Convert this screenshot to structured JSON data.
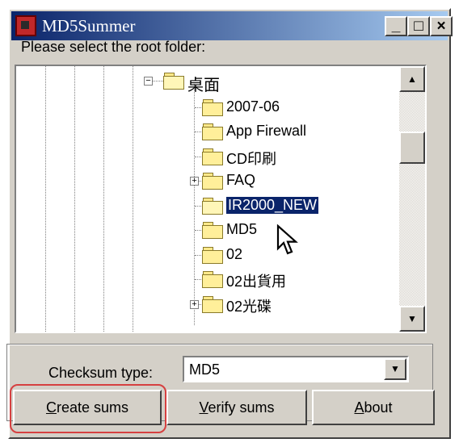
{
  "window": {
    "title": "MD5Summer",
    "minimize_glyph": "_",
    "maximize_glyph": "□",
    "close_glyph": "×"
  },
  "prompt": "Please select the root folder:",
  "tree": {
    "items": [
      {
        "label": "桌面",
        "open": true,
        "expander": "−",
        "selected": false
      },
      {
        "label": "2007-06",
        "open": false,
        "expander": "",
        "selected": false
      },
      {
        "label": "App Firewall",
        "open": false,
        "expander": "",
        "selected": false
      },
      {
        "label": "CD印刷",
        "open": false,
        "expander": "",
        "selected": false
      },
      {
        "label": "FAQ",
        "open": false,
        "expander": "+",
        "selected": false
      },
      {
        "label": "IR2000_NEW",
        "open": true,
        "expander": "",
        "selected": true
      },
      {
        "label": "MD5",
        "open": false,
        "expander": "",
        "selected": false
      },
      {
        "label": "02",
        "open": false,
        "expander": "",
        "selected": false
      },
      {
        "label": "02出貨用",
        "open": false,
        "expander": "",
        "selected": false
      },
      {
        "label": "02光碟",
        "open": false,
        "expander": "+",
        "selected": false
      }
    ],
    "scroll_up": "▲",
    "scroll_down": "▼"
  },
  "checksum": {
    "label": "Checksum type:",
    "value": "MD5",
    "arrow": "▼"
  },
  "buttons": {
    "create_label": "Create sums",
    "verify_label": "Verify sums",
    "about_label": "About"
  },
  "colors": {
    "highlight": "#d64040",
    "selection": "#0a246a",
    "title_bar": "#0a246a"
  }
}
